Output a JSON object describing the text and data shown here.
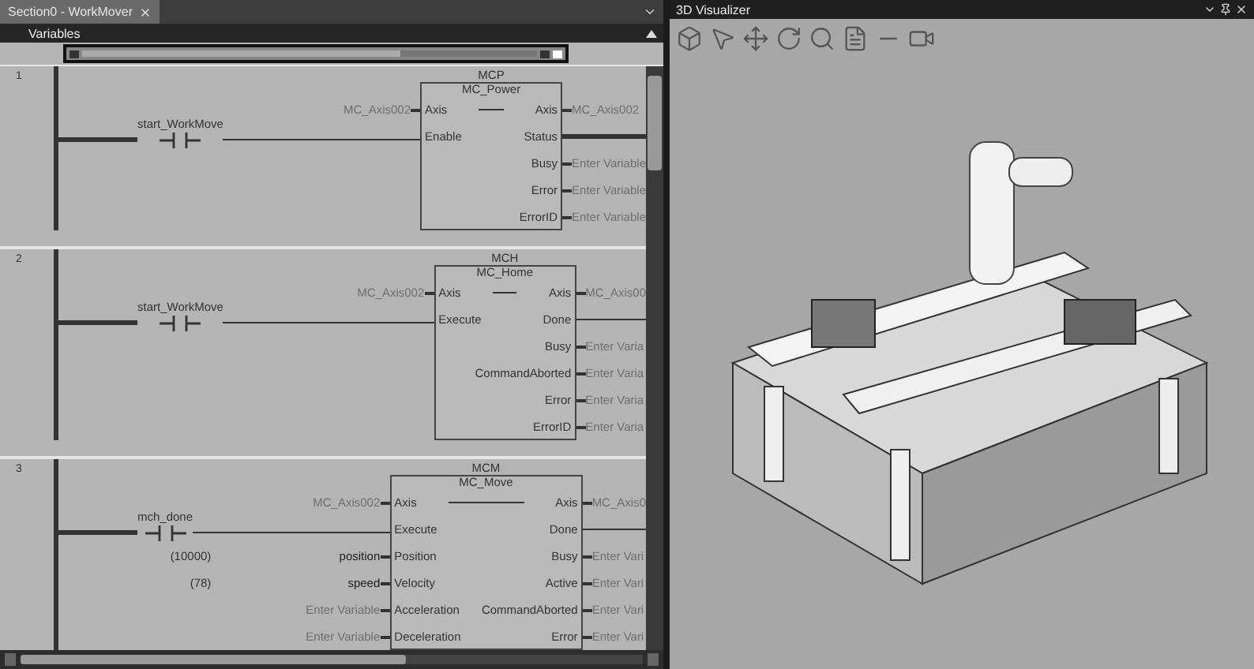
{
  "editor": {
    "tab": {
      "title": "Section0 - WorkMover"
    },
    "variables_bar": {
      "label": "Variables"
    },
    "rungs": [
      {
        "number": "1",
        "contact": {
          "label": "start_WorkMove"
        },
        "block": {
          "instance": "MCP",
          "type": "MC_Power",
          "inputs": [
            {
              "pin": "Axis",
              "variable": "MC_Axis002",
              "dimmed": true
            },
            {
              "pin": "Enable",
              "wired": true
            }
          ],
          "outputs": [
            {
              "pin": "Axis",
              "variable": "MC_Axis002",
              "dimmed": true
            },
            {
              "pin": "Status",
              "wired": true
            },
            {
              "pin": "Busy",
              "variable": "Enter Variable",
              "dimmed": true
            },
            {
              "pin": "Error",
              "variable": "Enter Variable",
              "dimmed": true
            },
            {
              "pin": "ErrorID",
              "variable": "Enter Variable",
              "dimmed": true
            }
          ]
        }
      },
      {
        "number": "2",
        "contact": {
          "label": "start_WorkMove"
        },
        "block": {
          "instance": "MCH",
          "type": "MC_Home",
          "inputs": [
            {
              "pin": "Axis",
              "variable": "MC_Axis002",
              "dimmed": true
            },
            {
              "pin": "Execute",
              "wired": true
            }
          ],
          "outputs": [
            {
              "pin": "Axis",
              "variable": "MC_Axis00",
              "dimmed": true
            },
            {
              "pin": "Done",
              "wired": true
            },
            {
              "pin": "Busy",
              "variable": "Enter Varia",
              "dimmed": true
            },
            {
              "pin": "CommandAborted",
              "variable": "Enter Varia",
              "dimmed": true
            },
            {
              "pin": "Error",
              "variable": "Enter Varia",
              "dimmed": true
            },
            {
              "pin": "ErrorID",
              "variable": "Enter Varia",
              "dimmed": true
            }
          ]
        }
      },
      {
        "number": "3",
        "contact": {
          "label": "mch_done"
        },
        "block": {
          "instance": "MCM",
          "type": "MC_Move",
          "inputs": [
            {
              "pin": "Axis",
              "variable": "MC_Axis002",
              "dimmed": true
            },
            {
              "pin": "Execute",
              "wired": true
            },
            {
              "pin": "Position",
              "variable": "position",
              "dimmed": false,
              "value": "(10000)"
            },
            {
              "pin": "Velocity",
              "variable": "speed",
              "dimmed": false,
              "value": "(78)"
            },
            {
              "pin": "Acceleration",
              "variable": "Enter Variable",
              "dimmed": true
            },
            {
              "pin": "Deceleration",
              "variable": "Enter Variable",
              "dimmed": true
            }
          ],
          "outputs": [
            {
              "pin": "Axis",
              "variable": "MC_Axis0",
              "dimmed": true
            },
            {
              "pin": "Done",
              "wired": true
            },
            {
              "pin": "Busy",
              "variable": "Enter Vari",
              "dimmed": true
            },
            {
              "pin": "Active",
              "variable": "Enter Vari",
              "dimmed": true
            },
            {
              "pin": "CommandAborted",
              "variable": "Enter Vari",
              "dimmed": true
            },
            {
              "pin": "Error",
              "variable": "Enter Vari",
              "dimmed": true
            }
          ]
        }
      }
    ]
  },
  "visualizer": {
    "title": "3D Visualizer"
  }
}
